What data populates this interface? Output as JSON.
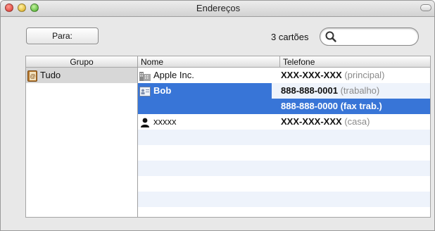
{
  "window": {
    "title": "Endereços"
  },
  "toolbar": {
    "to_button": "Para:",
    "count": "3 cartões",
    "search_value": ""
  },
  "columns": {
    "group": "Grupo",
    "name": "Nome",
    "phone": "Telefone"
  },
  "groups": [
    {
      "label": "Tudo",
      "icon": "address-book-icon"
    }
  ],
  "contacts": [
    {
      "name": "Apple Inc.",
      "icon": "building-icon",
      "phone": "XXX-XXX-XXX",
      "phone_label": "(principal)"
    },
    {
      "name": "Bob",
      "icon": "contact-card-icon",
      "phone": "888-888-0001",
      "phone_label": "(trabalho)",
      "phone2": "888-888-0000",
      "phone2_label": "(fax trab.)"
    },
    {
      "name": "xxxxx",
      "icon": "person-icon",
      "phone": "XXX-XXX-XXX",
      "phone_label": "(casa)"
    }
  ],
  "colors": {
    "selection": "#3875d7",
    "stripe": "#eef3fb",
    "group_selected": "#d7d7d7"
  }
}
